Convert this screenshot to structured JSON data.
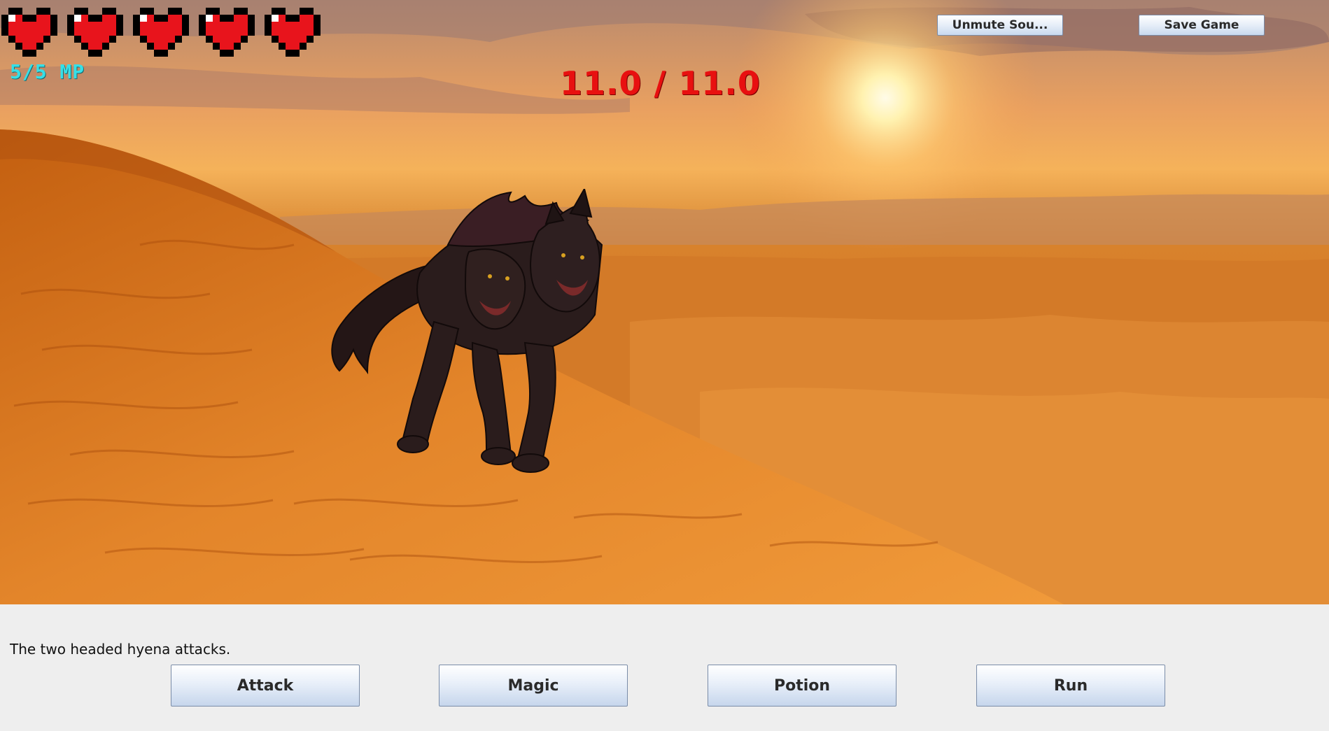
{
  "hud": {
    "hearts_full": 5,
    "hearts_total": 5,
    "mp_text": "5/5 MP",
    "enemy_hp_text": "11.0 / 11.0"
  },
  "toolbar": {
    "unmute_label": "Unmute Sou...",
    "save_label": "Save Game"
  },
  "log": {
    "message": "The two headed hyena attacks."
  },
  "actions": {
    "attack_label": "Attack",
    "magic_label": "Magic",
    "potion_label": "Potion",
    "run_label": "Run"
  },
  "colors": {
    "heart": "#e8141c",
    "mp": "#35e0e8",
    "enemy_hp": "#e81010"
  },
  "icons": [
    "heart-icon",
    "two-headed-hyena-sprite"
  ]
}
